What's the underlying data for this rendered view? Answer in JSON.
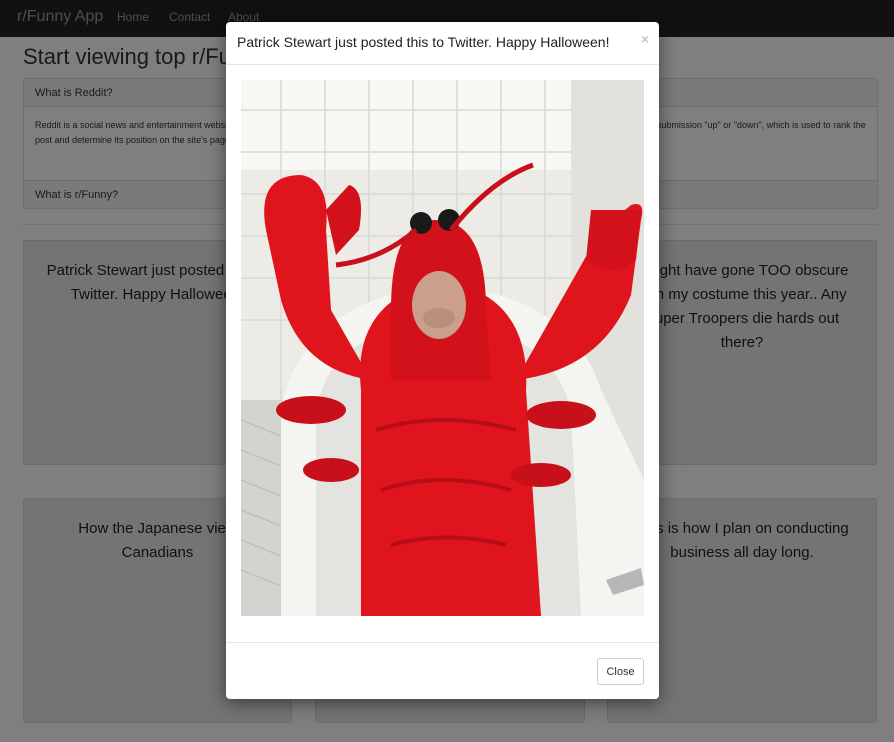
{
  "navbar": {
    "brand": "r/Funny App",
    "links": [
      "Home",
      "Contact",
      "About"
    ]
  },
  "page": {
    "title": "Start viewing top r/Funny posts",
    "accordion": [
      {
        "heading": "What is Reddit?",
        "body": "Reddit is a social news and entertainment website where registered users submit content in the form of either a link or a text post. Other users then vote the submission \"up\" or \"down\", which is used to rank the post and determine its position on the site's pages and front page. Content entries are organized by areas of interest called \"subreddits\"."
      },
      {
        "heading": "What is r/Funny?"
      }
    ],
    "posts": [
      "Patrick Stewart just posted this to Twitter. Happy Halloween!",
      "",
      "I might have gone TOO obscure with my costume this year.. Any Super Troopers die hards out there?",
      "How the Japanese view Canadians",
      "",
      "This is how I plan on conducting business all day long."
    ]
  },
  "modal": {
    "title": "Patrick Stewart just posted this to Twitter. Happy Halloween!",
    "close_glyph": "×",
    "close_button": "Close",
    "image_icon": "lobster-costume-photo"
  },
  "colors": {
    "navbar": "#222222",
    "backdrop": "rgba(0,0,0,0.5)",
    "costume_red": "#e0141c",
    "tile_white": "#f2f2ee"
  }
}
